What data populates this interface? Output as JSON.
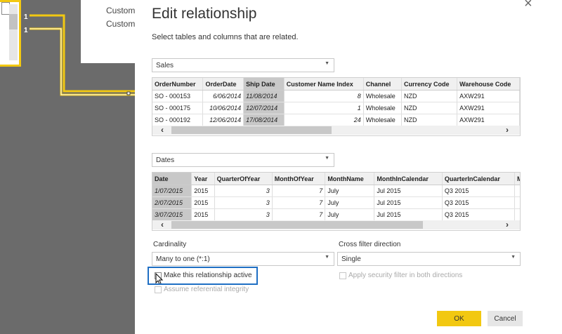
{
  "background": {
    "cardinality_marks": [
      "1",
      "1"
    ],
    "table_fields": [
      "Custome",
      "Custome"
    ]
  },
  "dialog": {
    "title": "Edit relationship",
    "subtitle": "Select tables and columns that are related.",
    "table1": {
      "name": "Sales",
      "columns": [
        "OrderNumber",
        "OrderDate",
        "Ship Date",
        "Customer Name Index",
        "Channel",
        "Currency Code",
        "Warehouse Code"
      ],
      "selected_column": "Ship Date",
      "rows": [
        [
          "SO - 000153",
          "6/06/2014",
          "11/08/2014",
          "8",
          "Wholesale",
          "NZD",
          "AXW291"
        ],
        [
          "SO - 000175",
          "10/06/2014",
          "12/07/2014",
          "1",
          "Wholesale",
          "NZD",
          "AXW291"
        ],
        [
          "SO - 000192",
          "12/06/2014",
          "17/08/2014",
          "24",
          "Wholesale",
          "NZD",
          "AXW291"
        ]
      ]
    },
    "table2": {
      "name": "Dates",
      "columns": [
        "Date",
        "Year",
        "QuarterOfYear",
        "MonthOfYear",
        "MonthName",
        "MonthInCalendar",
        "QuarterInCalendar",
        "Mo"
      ],
      "selected_column": "Date",
      "rows": [
        [
          "1/07/2015",
          "2015",
          "3",
          "7",
          "July",
          "Jul 2015",
          "Q3 2015",
          ""
        ],
        [
          "2/07/2015",
          "2015",
          "3",
          "7",
          "July",
          "Jul 2015",
          "Q3 2015",
          ""
        ],
        [
          "3/07/2015",
          "2015",
          "3",
          "7",
          "July",
          "Jul 2015",
          "Q3 2015",
          ""
        ]
      ]
    },
    "cardinality": {
      "label": "Cardinality",
      "value": "Many to one (*:1)"
    },
    "cross_filter": {
      "label": "Cross filter direction",
      "value": "Single"
    },
    "checkboxes": {
      "active": "Make this relationship active",
      "referential": "Assume referential integrity",
      "security": "Apply security filter in both directions"
    },
    "ok_label": "OK",
    "cancel_label": "Cancel"
  },
  "colors": {
    "accent": "#f2c811",
    "highlight": "#1f6fc4"
  },
  "icons": {
    "close": "close-icon",
    "dropdown": "chevron-down-icon",
    "scroll_left": "chevron-left-icon",
    "scroll_right": "chevron-right-icon"
  }
}
